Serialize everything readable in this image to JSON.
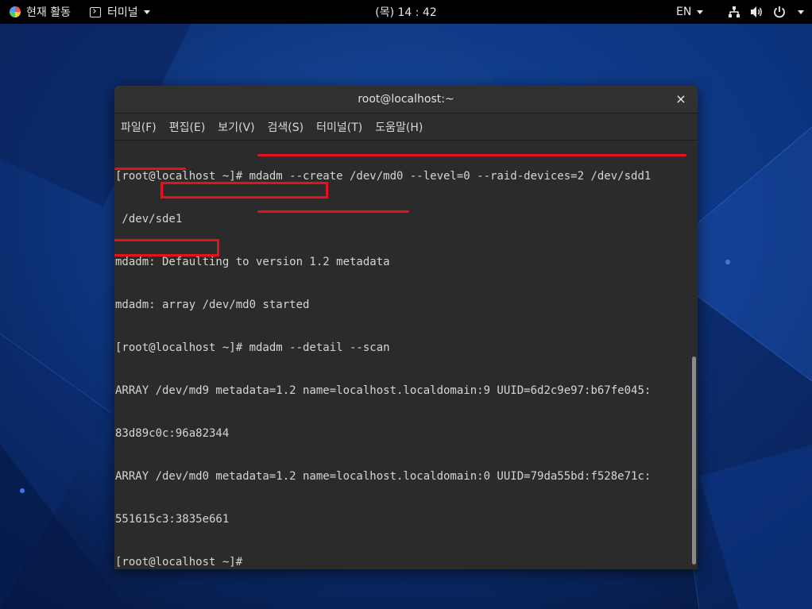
{
  "topbar": {
    "activities_label": "현재 활동",
    "app_menu_label": "터미널",
    "clock": "(목) 14 : 42",
    "language": "EN",
    "status_icons": [
      "network-icon",
      "volume-icon",
      "power-icon"
    ]
  },
  "window": {
    "title": "root@localhost:~",
    "close_glyph": "×"
  },
  "menubar": {
    "items": [
      "파일(F)",
      "편집(E)",
      "보기(V)",
      "검색(S)",
      "터미널(T)",
      "도움말(H)"
    ]
  },
  "terminal": {
    "lines": [
      "[root@localhost ~]# mdadm --create /dev/md0 --level=0 --raid-devices=2 /dev/sdd1",
      " /dev/sde1",
      "mdadm: Defaulting to version 1.2 metadata",
      "mdadm: array /dev/md0 started",
      "[root@localhost ~]# mdadm --detail --scan",
      "ARRAY /dev/md9 metadata=1.2 name=localhost.localdomain:9 UUID=6d2c9e97:b67fe045:",
      "83d89c0c:96a82344",
      "ARRAY /dev/md0 metadata=1.2 name=localhost.localdomain:0 UUID=79da55bd:f528e71c:",
      "551615c3:3835e661",
      "[root@localhost ~]# "
    ]
  },
  "colors": {
    "annotation": "#e3121b",
    "terminal_bg": "#2b2b2b",
    "terminal_fg": "#d3d7cf",
    "topbar_bg": "#000000"
  }
}
